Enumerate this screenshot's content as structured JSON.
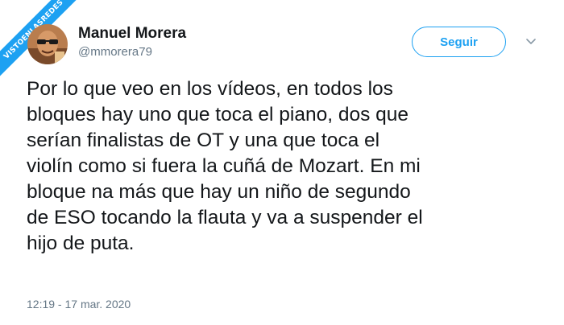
{
  "watermark": {
    "text": "VISTOENLASREDES"
  },
  "author": {
    "name": "Manuel Morera",
    "handle": "@mmorera79"
  },
  "actions": {
    "follow_label": "Seguir",
    "more_icon": "chevron-down-icon"
  },
  "tweet": {
    "text": "Por lo que veo en los vídeos, en todos los\nbloques hay uno que toca el piano, dos que\nserían finalistas de OT y una que toca el\nviolín como si fuera la cuñá de Mozart. En mi\nbloque na más que hay un niño de segundo\nde ESO tocando la flauta y va a suspender el\nhijo de puta.",
    "timestamp": "12:19 - 17 mar. 2020"
  },
  "colors": {
    "accent": "#1da1f2",
    "text": "#14171a",
    "muted": "#657786"
  }
}
